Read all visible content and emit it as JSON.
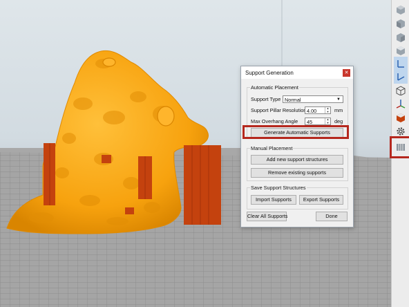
{
  "dialog": {
    "title": "Support Generation",
    "close_icon": "close-icon",
    "automatic_placement": {
      "group_label": "Automatic Placement",
      "support_type_label": "Support Type",
      "support_type_value": "Normal",
      "pillar_resolution_label": "Support Pillar Resolution",
      "pillar_resolution_value": "4.00",
      "pillar_resolution_unit": "mm",
      "overhang_angle_label": "Max Overhang Angle",
      "overhang_angle_value": "45",
      "overhang_angle_unit": "deg",
      "generate_button": "Generate Automatic Supports"
    },
    "manual_placement": {
      "group_label": "Manual Placement",
      "add_button": "Add new support structures",
      "remove_button": "Remove existing supports"
    },
    "save_structures": {
      "group_label": "Save Support Structures",
      "import_button": "Import Supports",
      "export_button": "Export Supports"
    },
    "clear_button": "Clear All Supports",
    "done_button": "Done"
  },
  "toolbar": {
    "buttons": [
      "view-iso-cube-icon",
      "view-front-cube-icon",
      "view-top-cube-icon",
      "view-side-cube-icon",
      "axis-icon",
      "wireframe-cube-icon",
      "axis-z-icon",
      "model-red-cube-icon",
      "gear-icon",
      "support-structures-icon"
    ]
  },
  "colors": {
    "model": "#f7a20e",
    "supports": "#c4420e",
    "highlight": "#b5281e",
    "bed": "#9a9a9a"
  }
}
